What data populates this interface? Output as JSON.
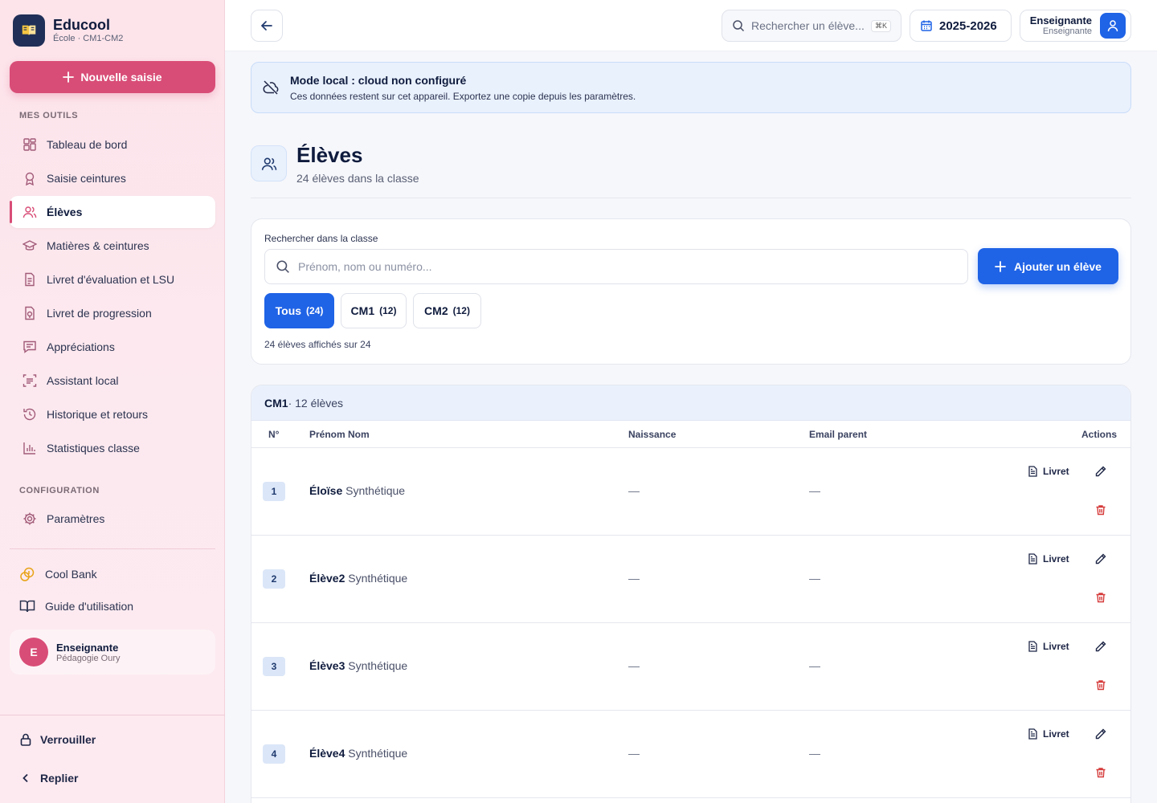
{
  "sidebar": {
    "brand_name": "Educool",
    "brand_sub": "École · CM1-CM2",
    "new_entry_label": "Nouvelle saisie",
    "section_tools": "MES OUTILS",
    "items": [
      {
        "label": "Tableau de bord",
        "icon": "dashboard-icon"
      },
      {
        "label": "Saisie ceintures",
        "icon": "award-icon"
      },
      {
        "label": "Élèves",
        "icon": "users-icon"
      },
      {
        "label": "Matières & ceintures",
        "icon": "graduation-cap-icon"
      },
      {
        "label": "Livret d'évaluation et LSU",
        "icon": "document-icon"
      },
      {
        "label": "Livret de progression",
        "icon": "progress-doc-icon"
      },
      {
        "label": "Appréciations",
        "icon": "comment-icon"
      },
      {
        "label": "Assistant local",
        "icon": "scan-icon"
      },
      {
        "label": "Historique et retours",
        "icon": "history-icon"
      },
      {
        "label": "Statistiques classe",
        "icon": "bar-chart-icon"
      }
    ],
    "section_config": "CONFIGURATION",
    "settings_label": "Paramètres",
    "links": [
      {
        "label": "Cool Bank",
        "icon": "coins-icon"
      },
      {
        "label": "Guide d'utilisation",
        "icon": "book-open-icon"
      }
    ],
    "user": {
      "initial": "E",
      "name": "Enseignante",
      "sub": "Pédagogie Oury"
    },
    "lock_label": "Verrouiller",
    "collapse_label": "Replier"
  },
  "topbar": {
    "search_placeholder": "Rechercher un élève...",
    "search_shortcut": "⌘K",
    "year": "2025-2026",
    "profile_name": "Enseignante",
    "profile_role": "Enseignante"
  },
  "banner": {
    "title": "Mode local : cloud non configuré",
    "text": "Ces données restent sur cet appareil. Exportez une copie depuis les paramètres."
  },
  "page": {
    "title": "Élèves",
    "subtitle": "24 élèves dans la classe"
  },
  "filters": {
    "label": "Rechercher dans la classe",
    "placeholder": "Prénom, nom ou numéro...",
    "add_label": "Ajouter un élève",
    "chips": [
      {
        "label": "Tous",
        "count": "(24)",
        "active": true
      },
      {
        "label": "CM1",
        "count": "(12)",
        "active": false
      },
      {
        "label": "CM2",
        "count": "(12)",
        "active": false
      }
    ],
    "result_count": "24 élèves affichés sur 24"
  },
  "table": {
    "group_name": "CM1",
    "group_count": " · 12 élèves",
    "columns": {
      "num": "N°",
      "name": "Prénom Nom",
      "birth": "Naissance",
      "email": "Email parent",
      "actions": "Actions"
    },
    "livret_label": "Livret",
    "rows": [
      {
        "num": "1",
        "first": "Éloïse",
        "last": "Synthétique",
        "birth": "—",
        "email": "—"
      },
      {
        "num": "2",
        "first": "Élève2",
        "last": "Synthétique",
        "birth": "—",
        "email": "—"
      },
      {
        "num": "3",
        "first": "Élève3",
        "last": "Synthétique",
        "birth": "—",
        "email": "—"
      },
      {
        "num": "4",
        "first": "Élève4",
        "last": "Synthétique",
        "birth": "—",
        "email": "—"
      }
    ]
  },
  "colors": {
    "accent_pink": "#d84d77",
    "accent_blue": "#1f63e6",
    "danger": "#d63a3a"
  }
}
